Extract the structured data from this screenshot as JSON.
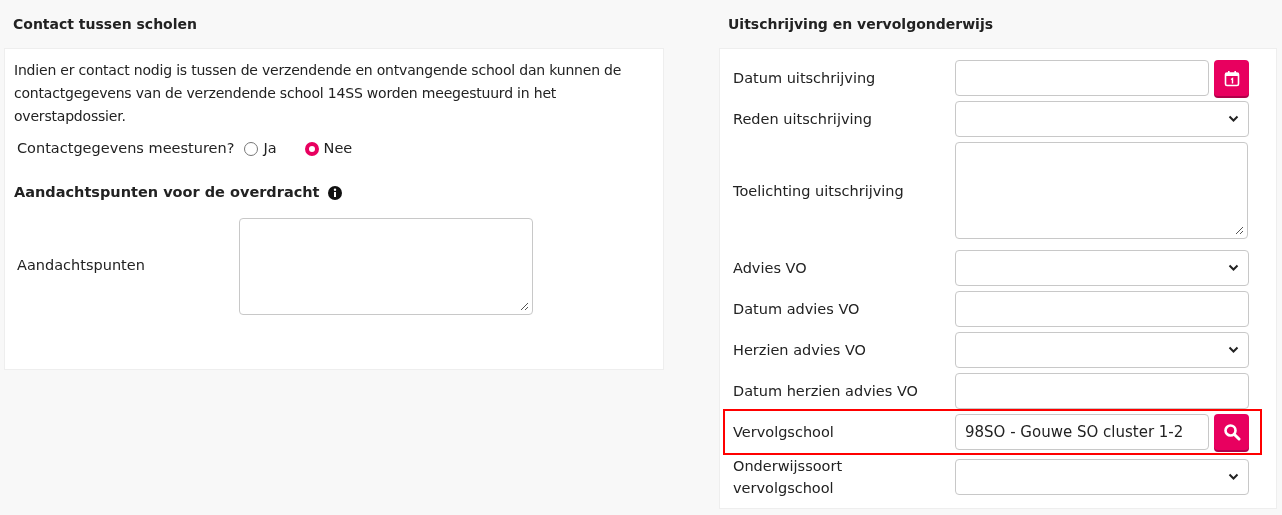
{
  "contact_section": {
    "title": "Contact tussen scholen",
    "intro": "Indien er contact nodig is tussen de verzendende en ontvangende school dan kunnen de contactgegevens van de verzendende school 14SS worden meegestuurd in het overstapdossier.",
    "send_question": {
      "label": "Contactgegevens meesturen?",
      "options": [
        {
          "label": "Ja",
          "selected": false
        },
        {
          "label": "Nee",
          "selected": true
        }
      ]
    },
    "attention_heading": "Aandachtspunten voor de overdracht",
    "attention_field": {
      "label": "Aandachtspunten"
    }
  },
  "deregistration_section": {
    "title": "Uitschrijving en vervolgonderwijs",
    "fields": [
      {
        "kind": "date",
        "label": "Datum uitschrijving",
        "highlighted": false
      },
      {
        "kind": "select",
        "label": "Reden uitschrijving",
        "highlighted": false
      },
      {
        "kind": "textarea",
        "label": "Toelichting uitschrijving",
        "highlighted": false
      },
      {
        "kind": "select",
        "label": "Advies VO",
        "highlighted": false
      },
      {
        "kind": "text",
        "label": "Datum advies VO",
        "highlighted": false
      },
      {
        "kind": "select",
        "label": "Herzien advies VO",
        "highlighted": false
      },
      {
        "kind": "text",
        "label": "Datum herzien advies VO",
        "highlighted": false
      },
      {
        "kind": "search",
        "label": "Vervolgschool",
        "value": "98SO - Gouwe SO cluster 1-2",
        "highlighted": true
      },
      {
        "kind": "select",
        "label": "Onderwijssoort vervolgschool",
        "highlighted": false
      }
    ]
  }
}
